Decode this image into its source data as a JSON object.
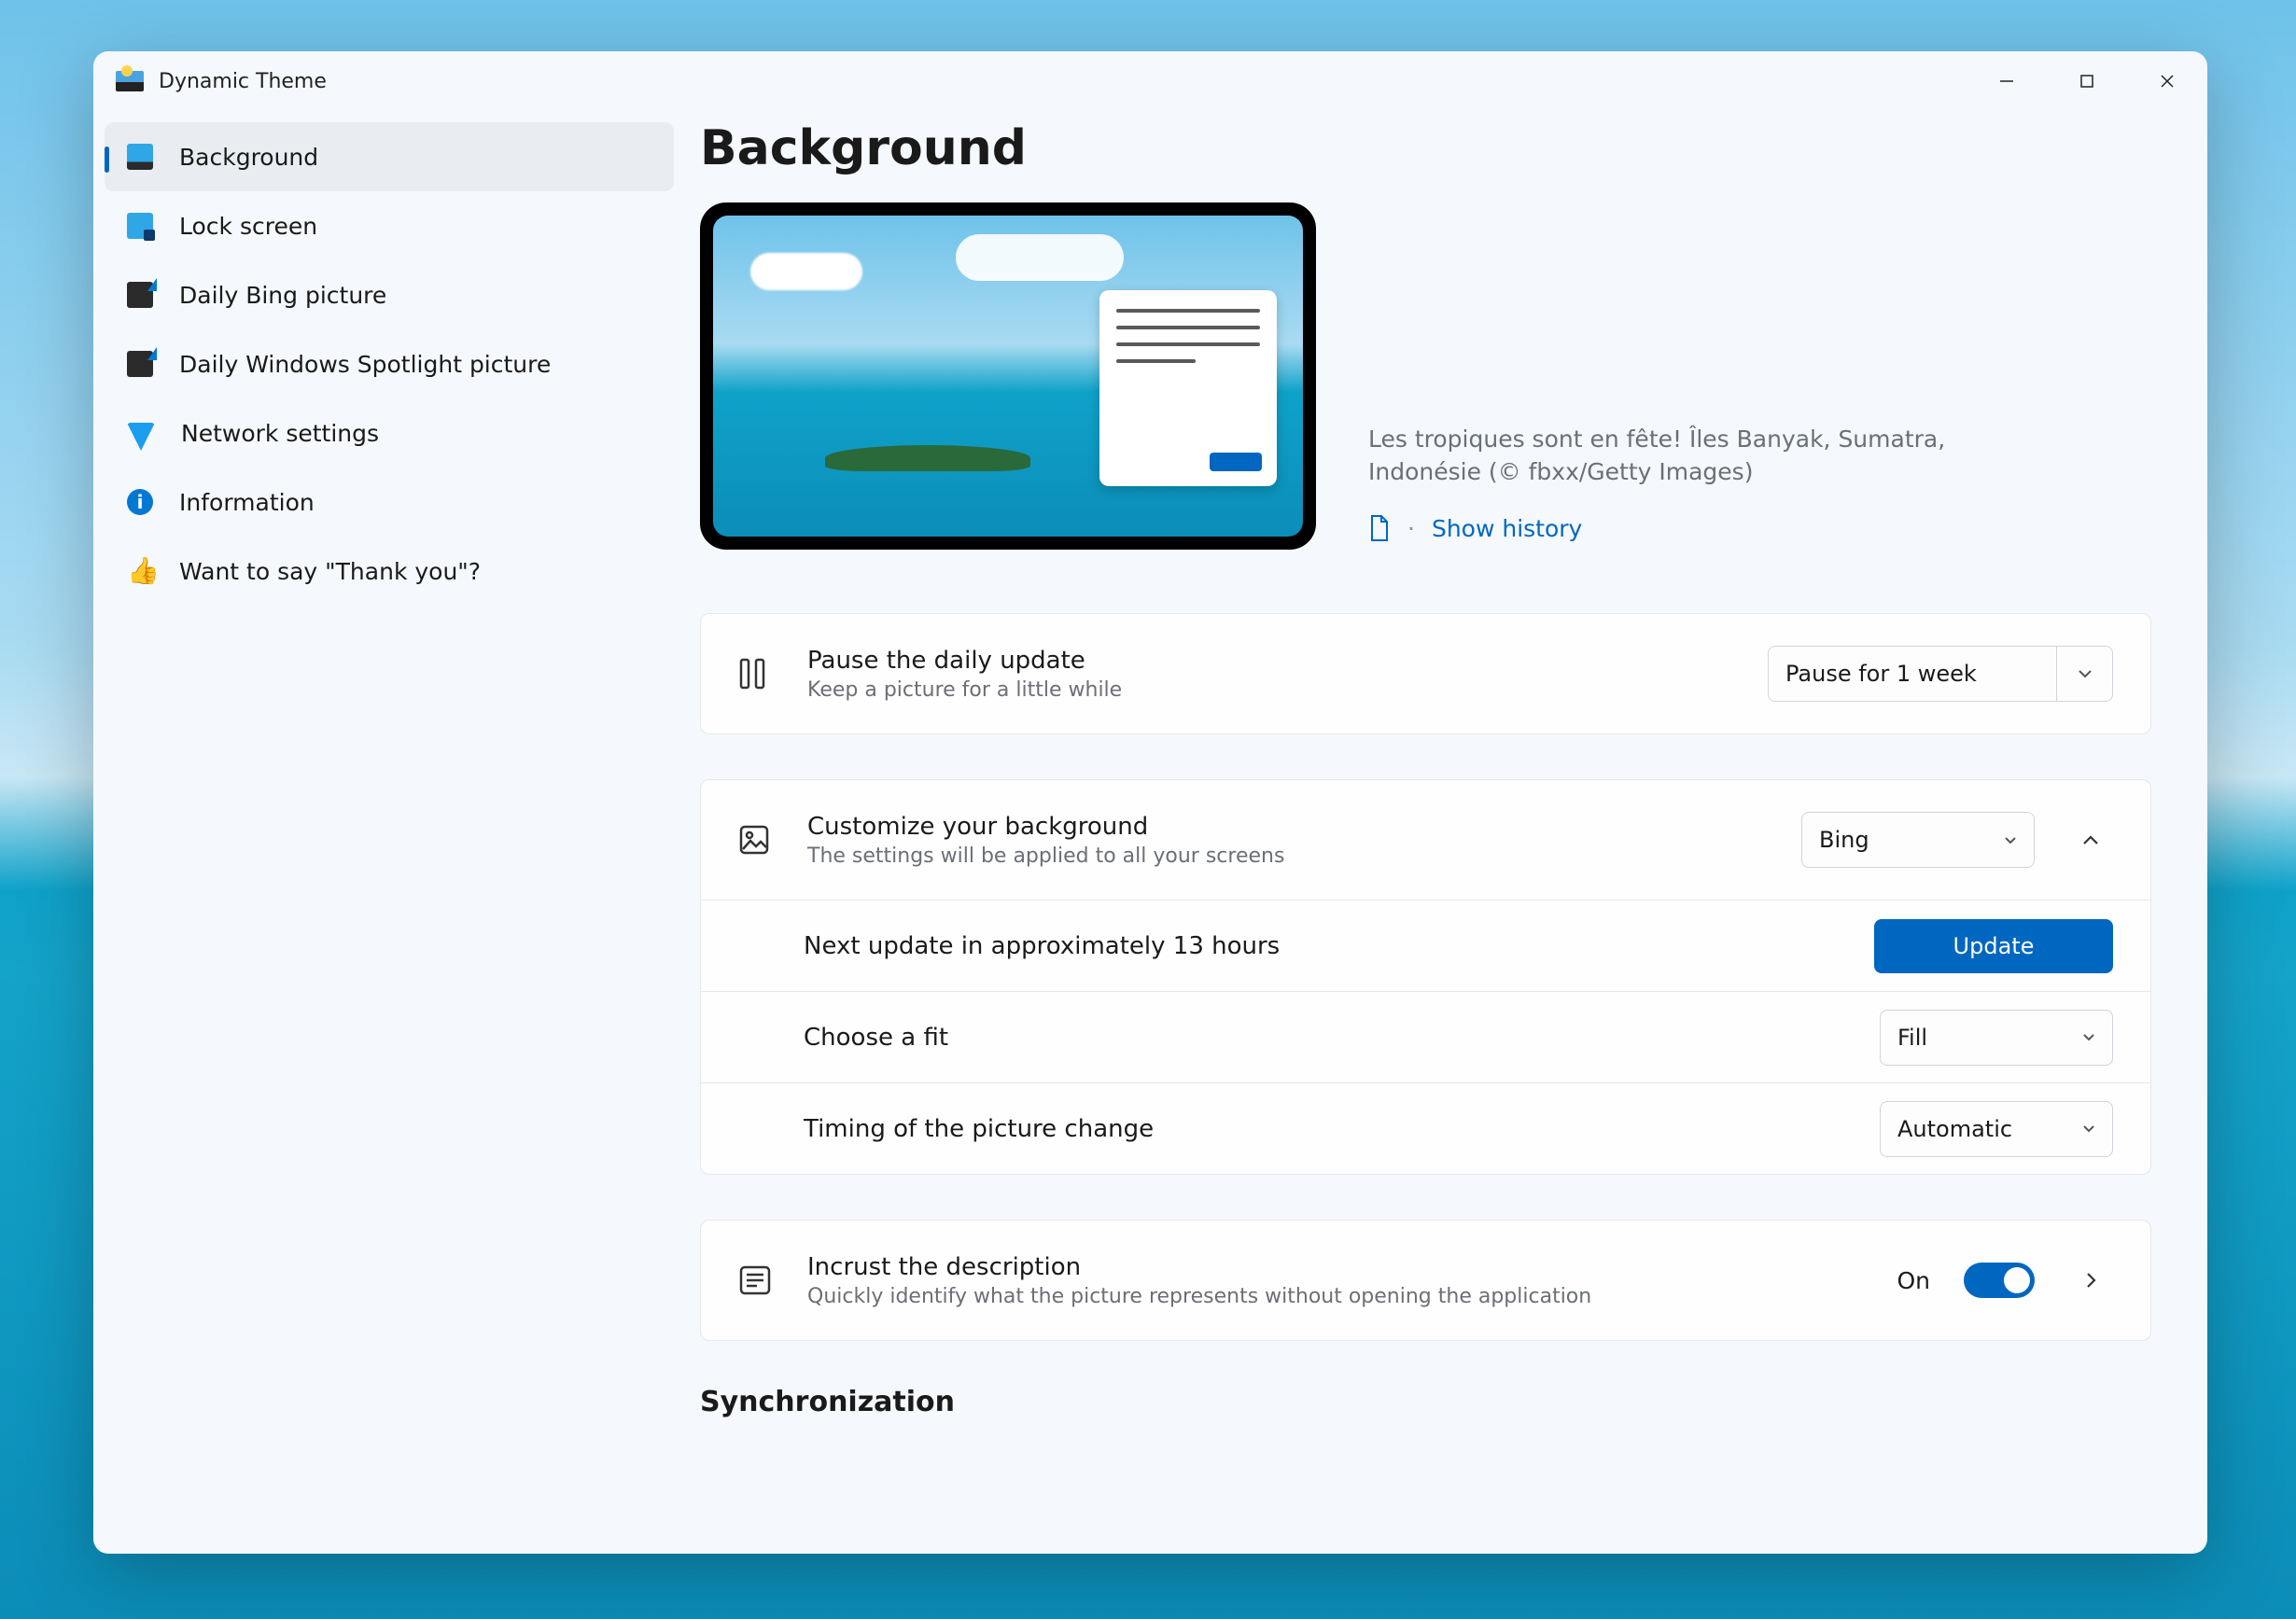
{
  "app": {
    "title": "Dynamic Theme"
  },
  "sidebar": {
    "items": [
      {
        "label": "Background"
      },
      {
        "label": "Lock screen"
      },
      {
        "label": "Daily Bing picture"
      },
      {
        "label": "Daily Windows Spotlight picture"
      },
      {
        "label": "Network settings"
      },
      {
        "label": "Information"
      },
      {
        "label": "Want to say \"Thank you\"?"
      }
    ]
  },
  "page": {
    "title": "Background",
    "caption": "Les tropiques sont en fête! Îles Banyak, Sumatra, Indonésie (© fbxx/Getty Images)",
    "show_history": "Show history"
  },
  "pause": {
    "title": "Pause the daily update",
    "desc": "Keep a picture for a little while",
    "value": "Pause for 1 week"
  },
  "customize": {
    "title": "Customize your background",
    "desc": "The settings will be applied to all your screens",
    "source_value": "Bing",
    "next_update": "Next update in approximately 13 hours",
    "update_btn": "Update",
    "fit_label": "Choose a fit",
    "fit_value": "Fill",
    "timing_label": "Timing of the picture change",
    "timing_value": "Automatic"
  },
  "incrust": {
    "title": "Incrust the description",
    "desc": "Quickly identify what the picture represents without opening the application",
    "state_label": "On"
  },
  "sync": {
    "heading": "Synchronization"
  }
}
